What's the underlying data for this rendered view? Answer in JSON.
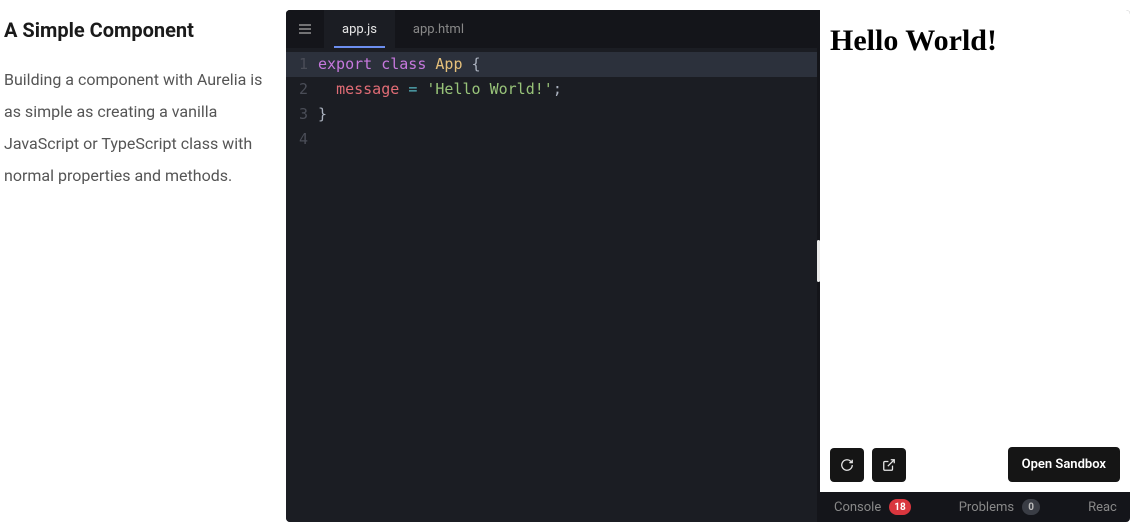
{
  "article": {
    "heading": "A Simple Component",
    "body": "Building a component with Aurelia is as simple as creating a vanilla JavaScript or TypeScript class with normal properties and methods."
  },
  "editor": {
    "tabs": [
      {
        "label": "app.js",
        "active": true
      },
      {
        "label": "app.html",
        "active": false
      }
    ],
    "code_lines": [
      {
        "num": "1",
        "highlight": true,
        "tokens": [
          {
            "t": "export",
            "c": "tok-kw"
          },
          {
            "t": " ",
            "c": ""
          },
          {
            "t": "class",
            "c": "tok-kw"
          },
          {
            "t": " ",
            "c": ""
          },
          {
            "t": "App",
            "c": "tok-cls"
          },
          {
            "t": " ",
            "c": ""
          },
          {
            "t": "{",
            "c": "tok-punc"
          }
        ]
      },
      {
        "num": "2",
        "highlight": false,
        "tokens": [
          {
            "t": "  ",
            "c": ""
          },
          {
            "t": "message",
            "c": "tok-prop"
          },
          {
            "t": " ",
            "c": ""
          },
          {
            "t": "=",
            "c": "tok-op"
          },
          {
            "t": " ",
            "c": ""
          },
          {
            "t": "'Hello World!'",
            "c": "tok-str"
          },
          {
            "t": ";",
            "c": "tok-punc"
          }
        ]
      },
      {
        "num": "3",
        "highlight": false,
        "tokens": [
          {
            "t": "}",
            "c": "tok-punc"
          }
        ]
      },
      {
        "num": "4",
        "highlight": false,
        "tokens": []
      }
    ]
  },
  "preview": {
    "output": "Hello World!",
    "open_label": "Open Sandbox"
  },
  "bottom": {
    "console_label": "Console",
    "console_count": "18",
    "problems_label": "Problems",
    "problems_count": "0",
    "react_label": "Reac"
  }
}
